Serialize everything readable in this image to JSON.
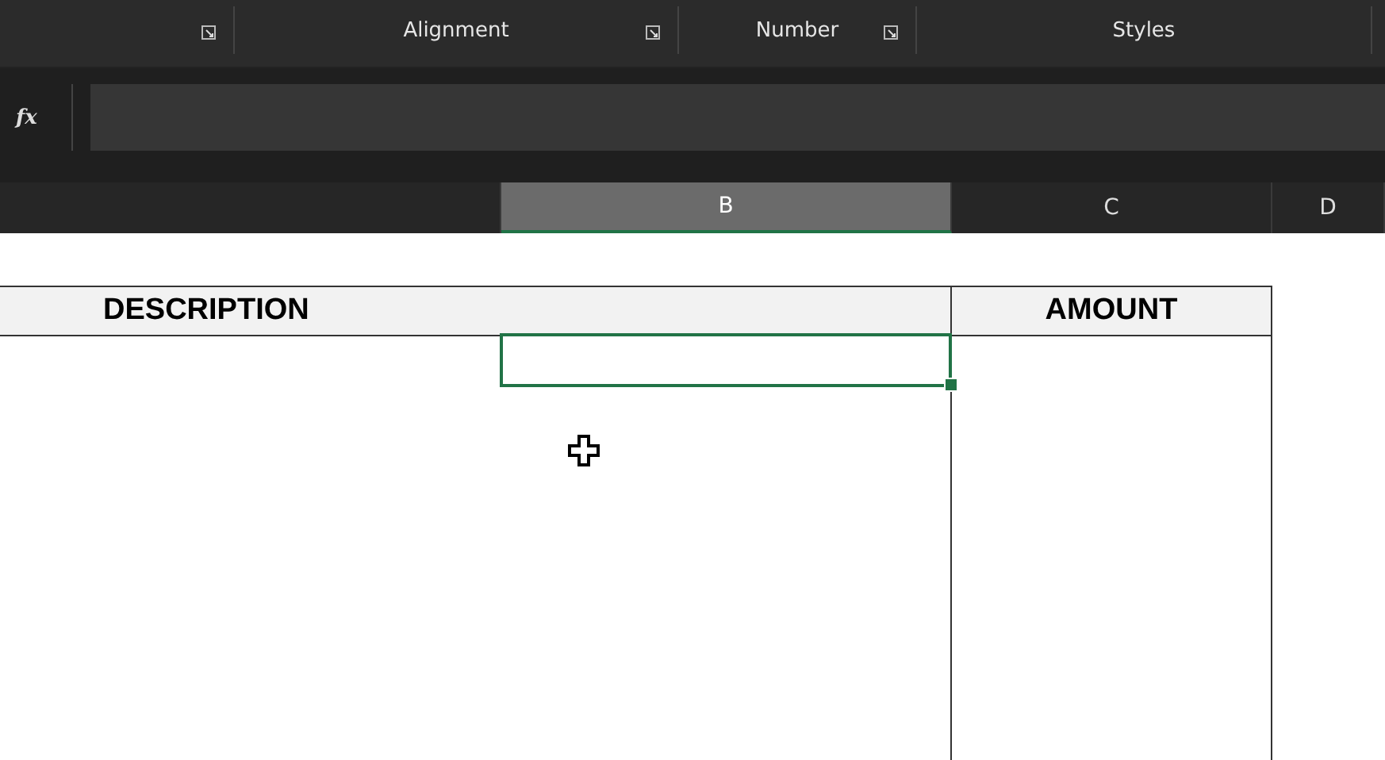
{
  "ribbon_groups": [
    {
      "launcher": true
    },
    {
      "label": "Alignment",
      "launcher": true
    },
    {
      "label": "Number",
      "launcher": true
    },
    {
      "label": "Styles",
      "launcher": false
    }
  ],
  "formula_bar": {
    "icon": "fx"
  },
  "column_headers": [
    {
      "label": "B",
      "selected": true
    },
    {
      "label": "C",
      "selected": false
    },
    {
      "label": "D",
      "selected": false
    }
  ],
  "table": {
    "columns": [
      "DESCRIPTION",
      "AMOUNT"
    ]
  }
}
